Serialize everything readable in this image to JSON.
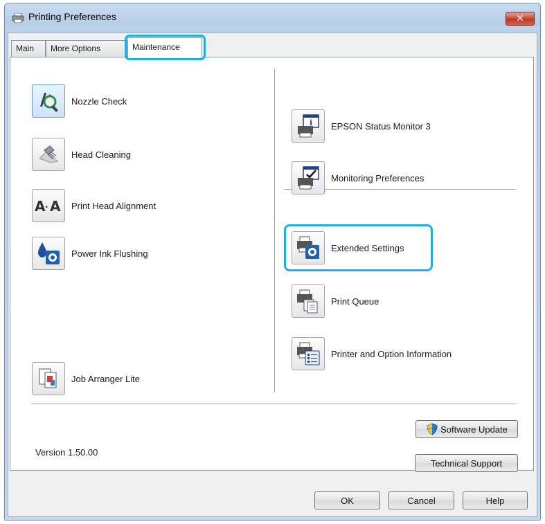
{
  "window": {
    "title": "Printing Preferences",
    "close_glyph": "✕"
  },
  "tabs": [
    {
      "label": "Main"
    },
    {
      "label": "More Options"
    },
    {
      "label": "Maintenance",
      "active": true
    }
  ],
  "left_items": [
    {
      "label": "Nozzle Check",
      "icon": "nozzle-check-icon"
    },
    {
      "label": "Head Cleaning",
      "icon": "head-cleaning-icon"
    },
    {
      "label": "Print Head Alignment",
      "icon": "print-head-alignment-icon"
    },
    {
      "label": "Power Ink Flushing",
      "icon": "power-ink-flushing-icon"
    },
    {
      "label": "Job Arranger Lite",
      "icon": "job-arranger-icon"
    }
  ],
  "right_items": [
    {
      "label": "EPSON Status Monitor 3",
      "icon": "status-monitor-icon"
    },
    {
      "label": "Monitoring Preferences",
      "icon": "monitoring-preferences-icon"
    },
    {
      "label": "Extended Settings",
      "icon": "extended-settings-icon"
    },
    {
      "label": "Print Queue",
      "icon": "print-queue-icon"
    },
    {
      "label": "Printer and Option Information",
      "icon": "printer-info-icon"
    }
  ],
  "software_update_label": "Software Update",
  "technical_support_label": "Technical Support",
  "version_text": "Version 1.50.00",
  "footer": {
    "ok_label": "OK",
    "cancel_label": "Cancel",
    "help_label": "Help"
  },
  "colors": {
    "highlight": "#22aee6",
    "accent": "#1f62a8"
  }
}
